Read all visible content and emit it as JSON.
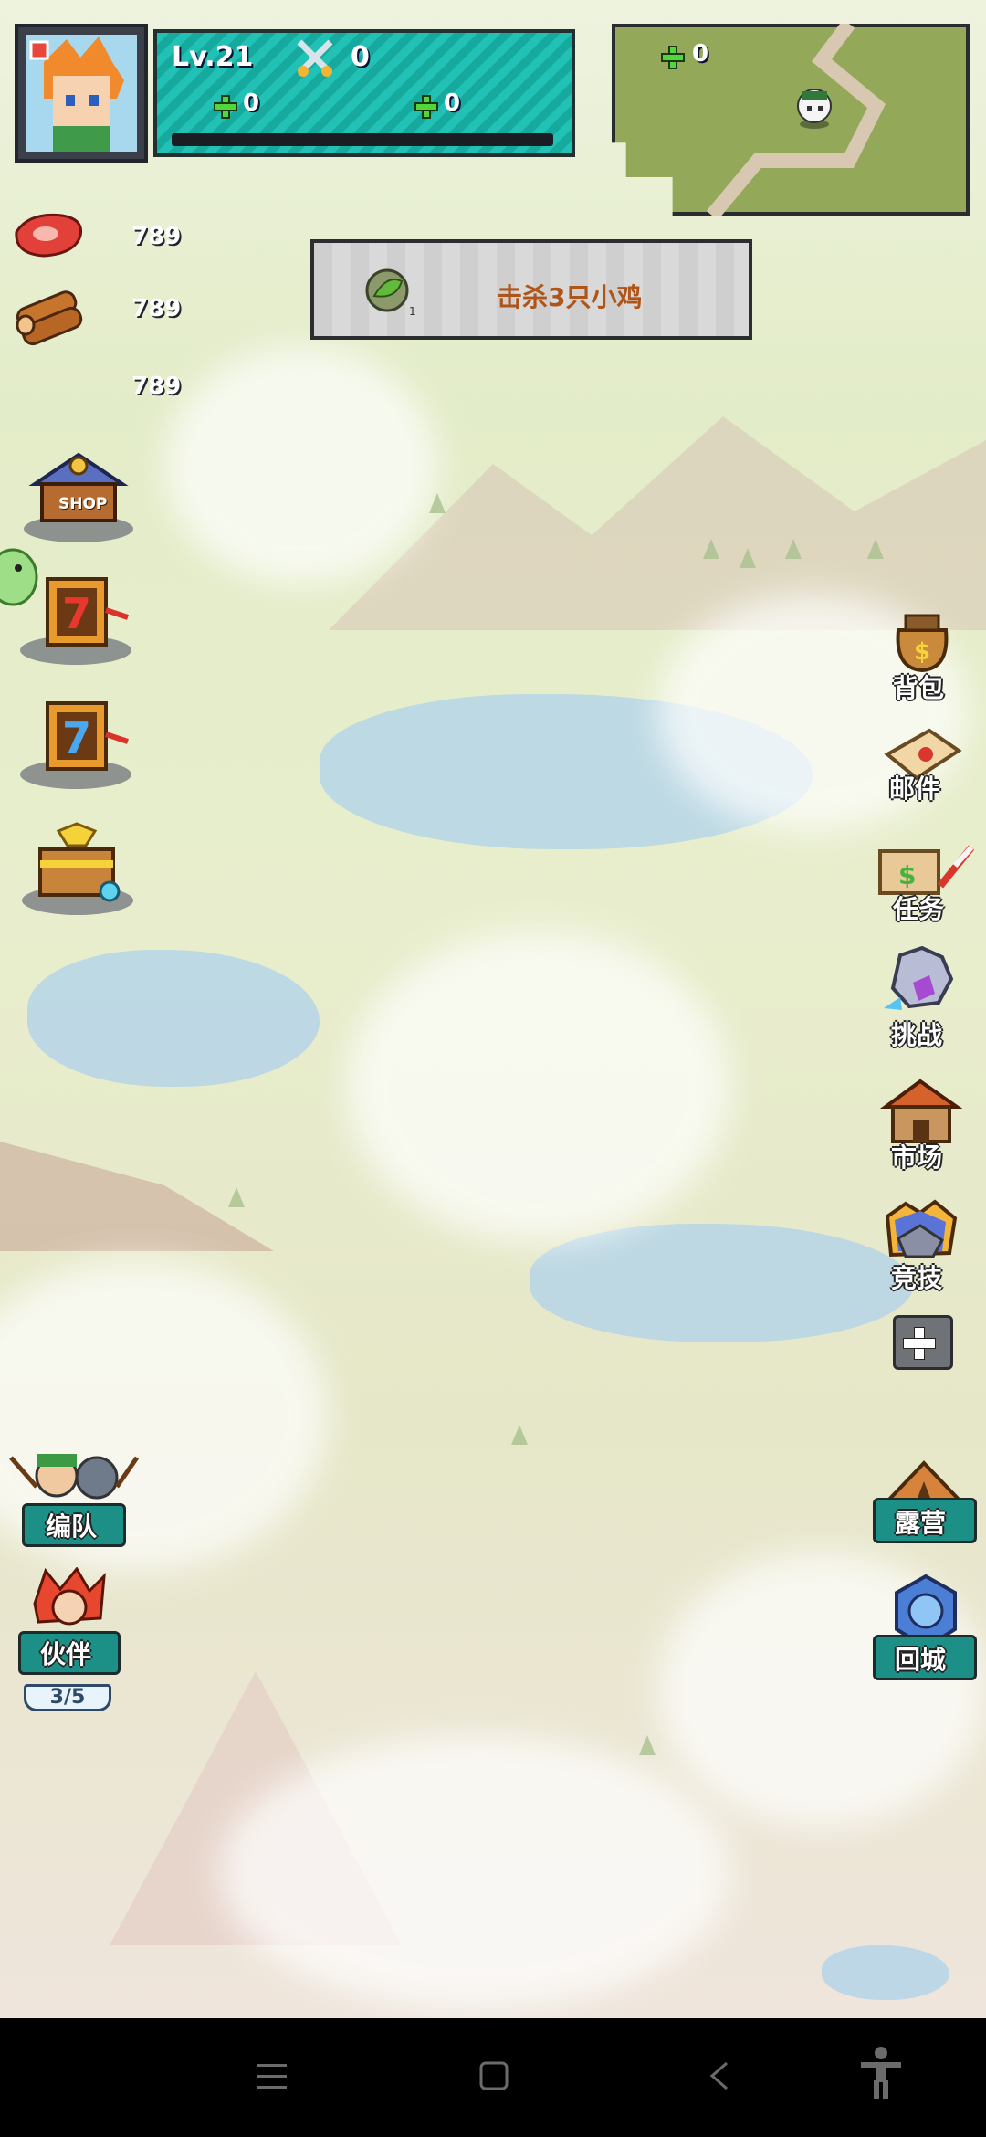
{
  "player": {
    "level": "Lv.21",
    "power": "0",
    "stat_a": "0",
    "stat_b": "0"
  },
  "minimap": {
    "value": "0"
  },
  "resources": [
    {
      "icon": "meat-icon",
      "value": "789"
    },
    {
      "icon": "wood-icon",
      "value": "789"
    },
    {
      "icon": "stone-icon",
      "value": "789"
    }
  ],
  "quest": {
    "text": "击杀3只小鸡",
    "badge": "1"
  },
  "left_buttons": {
    "shop": "SHOP",
    "formation": "编队",
    "partner": "伙伴",
    "partner_count": "3/5"
  },
  "right_menu": [
    "背包",
    "邮件",
    "任务",
    "挑战",
    "市场",
    "竞技"
  ],
  "right_bottom": {
    "camp": "露营",
    "return": "回城"
  },
  "colors": {
    "hud_teal": "#1ab3a8",
    "quest_text": "#b0551a",
    "plus_green": "#52d63b"
  }
}
